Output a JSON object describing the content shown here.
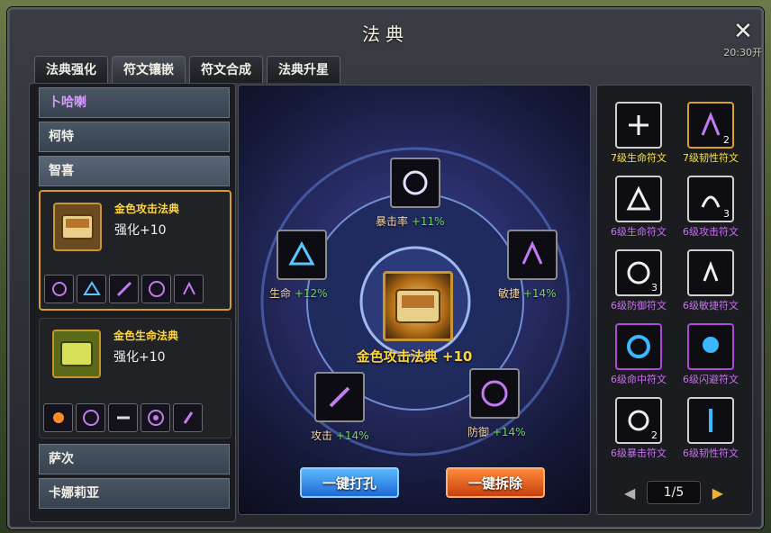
{
  "window": {
    "title": "法典",
    "clock": "20:30开"
  },
  "tabs": [
    "法典强化",
    "符文镶嵌",
    "符文合成",
    "法典升星"
  ],
  "characters": [
    "卜哈喇",
    "柯特",
    "智喜",
    "萨次",
    "卡娜莉亚"
  ],
  "books": [
    {
      "name": "金色攻击法典",
      "level": "强化+10"
    },
    {
      "name": "金色生命法典",
      "level": "强化+10"
    }
  ],
  "center": {
    "main_book": "金色攻击法典 +10",
    "slots": [
      {
        "label": "暴击率",
        "value": "+11%"
      },
      {
        "label": "生命",
        "value": "+12%"
      },
      {
        "label": "敏捷",
        "value": "+14%"
      },
      {
        "label": "攻击",
        "value": "+14%"
      },
      {
        "label": "防御",
        "value": "+14%"
      }
    ],
    "btn_punch": "一键打孔",
    "btn_remove": "一键拆除"
  },
  "runes": [
    {
      "name": "7级生命符文",
      "count": "",
      "icon": "life-icon"
    },
    {
      "name": "7级韧性符文",
      "count": "2",
      "icon": "tenacity-icon"
    },
    {
      "name": "6级生命符文",
      "count": "",
      "icon": "life-icon"
    },
    {
      "name": "6级攻击符文",
      "count": "3",
      "icon": "attack-icon"
    },
    {
      "name": "6级防御符文",
      "count": "3",
      "icon": "defense-icon"
    },
    {
      "name": "6级敏捷符文",
      "count": "",
      "icon": "agility-icon"
    },
    {
      "name": "6级命中符文",
      "count": "",
      "icon": "hit-icon"
    },
    {
      "name": "6级闪避符文",
      "count": "",
      "icon": "dodge-icon"
    },
    {
      "name": "6级暴击符文",
      "count": "2",
      "icon": "crit-icon"
    },
    {
      "name": "6级韧性符文",
      "count": "",
      "icon": "tenacity-icon"
    }
  ],
  "pager": {
    "text": "1/5"
  }
}
